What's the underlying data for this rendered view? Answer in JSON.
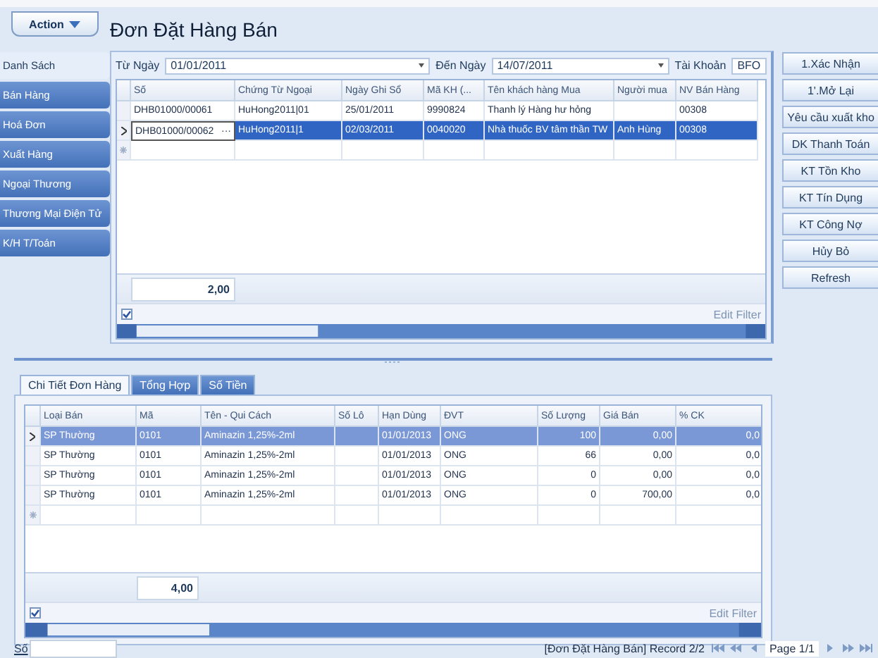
{
  "action_button": {
    "label": "Action"
  },
  "title": "Đơn Đặt Hàng Bán",
  "sidebar": [
    {
      "label": "Danh Sách",
      "selected": true
    },
    {
      "label": "Bán Hàng",
      "selected": false
    },
    {
      "label": "Hoá Đơn",
      "selected": false
    },
    {
      "label": "Xuất Hàng",
      "selected": false
    },
    {
      "label": "Ngoại Thương",
      "selected": false
    },
    {
      "label": "Thương Mại Điện Tử",
      "selected": false
    },
    {
      "label": "K/H T/Toán",
      "selected": false
    }
  ],
  "filters": {
    "from_label": "Từ Ngày",
    "from_value": "01/01/2011",
    "to_label": "Đến Ngày",
    "to_value": "14/07/2011",
    "account_label": "Tài Khoản",
    "account_value": "BFO"
  },
  "orders": {
    "columns": [
      {
        "label": "Số",
        "total": "2,00"
      },
      {
        "label": "Chứng Từ Ngoại"
      },
      {
        "label": "Ngày Ghi Sổ"
      },
      {
        "label": "Mã KH (..."
      },
      {
        "label": "Tên khách hàng Mua"
      },
      {
        "label": "Người mua"
      },
      {
        "label": "NV Bán Hàng"
      }
    ],
    "rows": [
      {
        "cells": [
          "DHB01000/00061",
          "HuHong2011|01",
          "25/01/2011",
          "9990824",
          "Thanh lý Hàng hư hỏng",
          "",
          "00308"
        ],
        "selected": false
      },
      {
        "cells": [
          "DHB01000/00062",
          "HuHong2011|1",
          "02/03/2011",
          "0040020",
          "Nhà thuốc BV tâm thần TW",
          "Anh Hùng",
          "00308"
        ],
        "selected": true,
        "editor": "···"
      }
    ],
    "filter_checked": true,
    "edit_filter": "Edit Filter"
  },
  "actions": [
    "1.Xác Nhận",
    "1'.Mở Lại",
    "Yêu cầu xuất kho",
    "DK Thanh Toán",
    "KT Tồn Kho",
    "KT Tín Dụng",
    "KT Công Nợ",
    "Hủy Bỏ",
    "Refresh"
  ],
  "detail_tabs": [
    {
      "label": "Chi Tiết Đơn Hàng",
      "selected": true
    },
    {
      "label": "Tổng Hợp",
      "selected": false
    },
    {
      "label": "Số Tiền",
      "selected": false
    }
  ],
  "details": {
    "columns": [
      {
        "label": "Loại Bán"
      },
      {
        "label": "Mã",
        "total": "4,00"
      },
      {
        "label": "Tên - Qui Cách"
      },
      {
        "label": "Số Lô"
      },
      {
        "label": "Hạn Dùng"
      },
      {
        "label": "ĐVT"
      },
      {
        "label": "Số Lượng"
      },
      {
        "label": "Giá Bán"
      },
      {
        "label": "% CK"
      }
    ],
    "rows": [
      {
        "cells": [
          "SP Thường",
          "0101",
          "Aminazin 1,25%-2ml",
          "",
          "01/01/2013",
          "ONG",
          "100",
          "0,00",
          "0,0"
        ],
        "selected": true
      },
      {
        "cells": [
          "SP Thường",
          "0101",
          "Aminazin 1,25%-2ml",
          "",
          "01/01/2013",
          "ONG",
          "66",
          "0,00",
          "0,0"
        ],
        "selected": false
      },
      {
        "cells": [
          "SP Thường",
          "0101",
          "Aminazin 1,25%-2ml",
          "",
          "01/01/2013",
          "ONG",
          "0",
          "0,00",
          "0,0"
        ],
        "selected": false
      },
      {
        "cells": [
          "SP Thường",
          "0101",
          "Aminazin 1,25%-2ml",
          "",
          "01/01/2013",
          "ONG",
          "0",
          "700,00",
          "0,0"
        ],
        "selected": false
      }
    ],
    "filter_checked": true,
    "edit_filter": "Edit Filter"
  },
  "status": {
    "search_label": "Số",
    "record": "[Đơn Đặt Hàng Bán] Record 2/2",
    "page": "Page 1/1"
  }
}
